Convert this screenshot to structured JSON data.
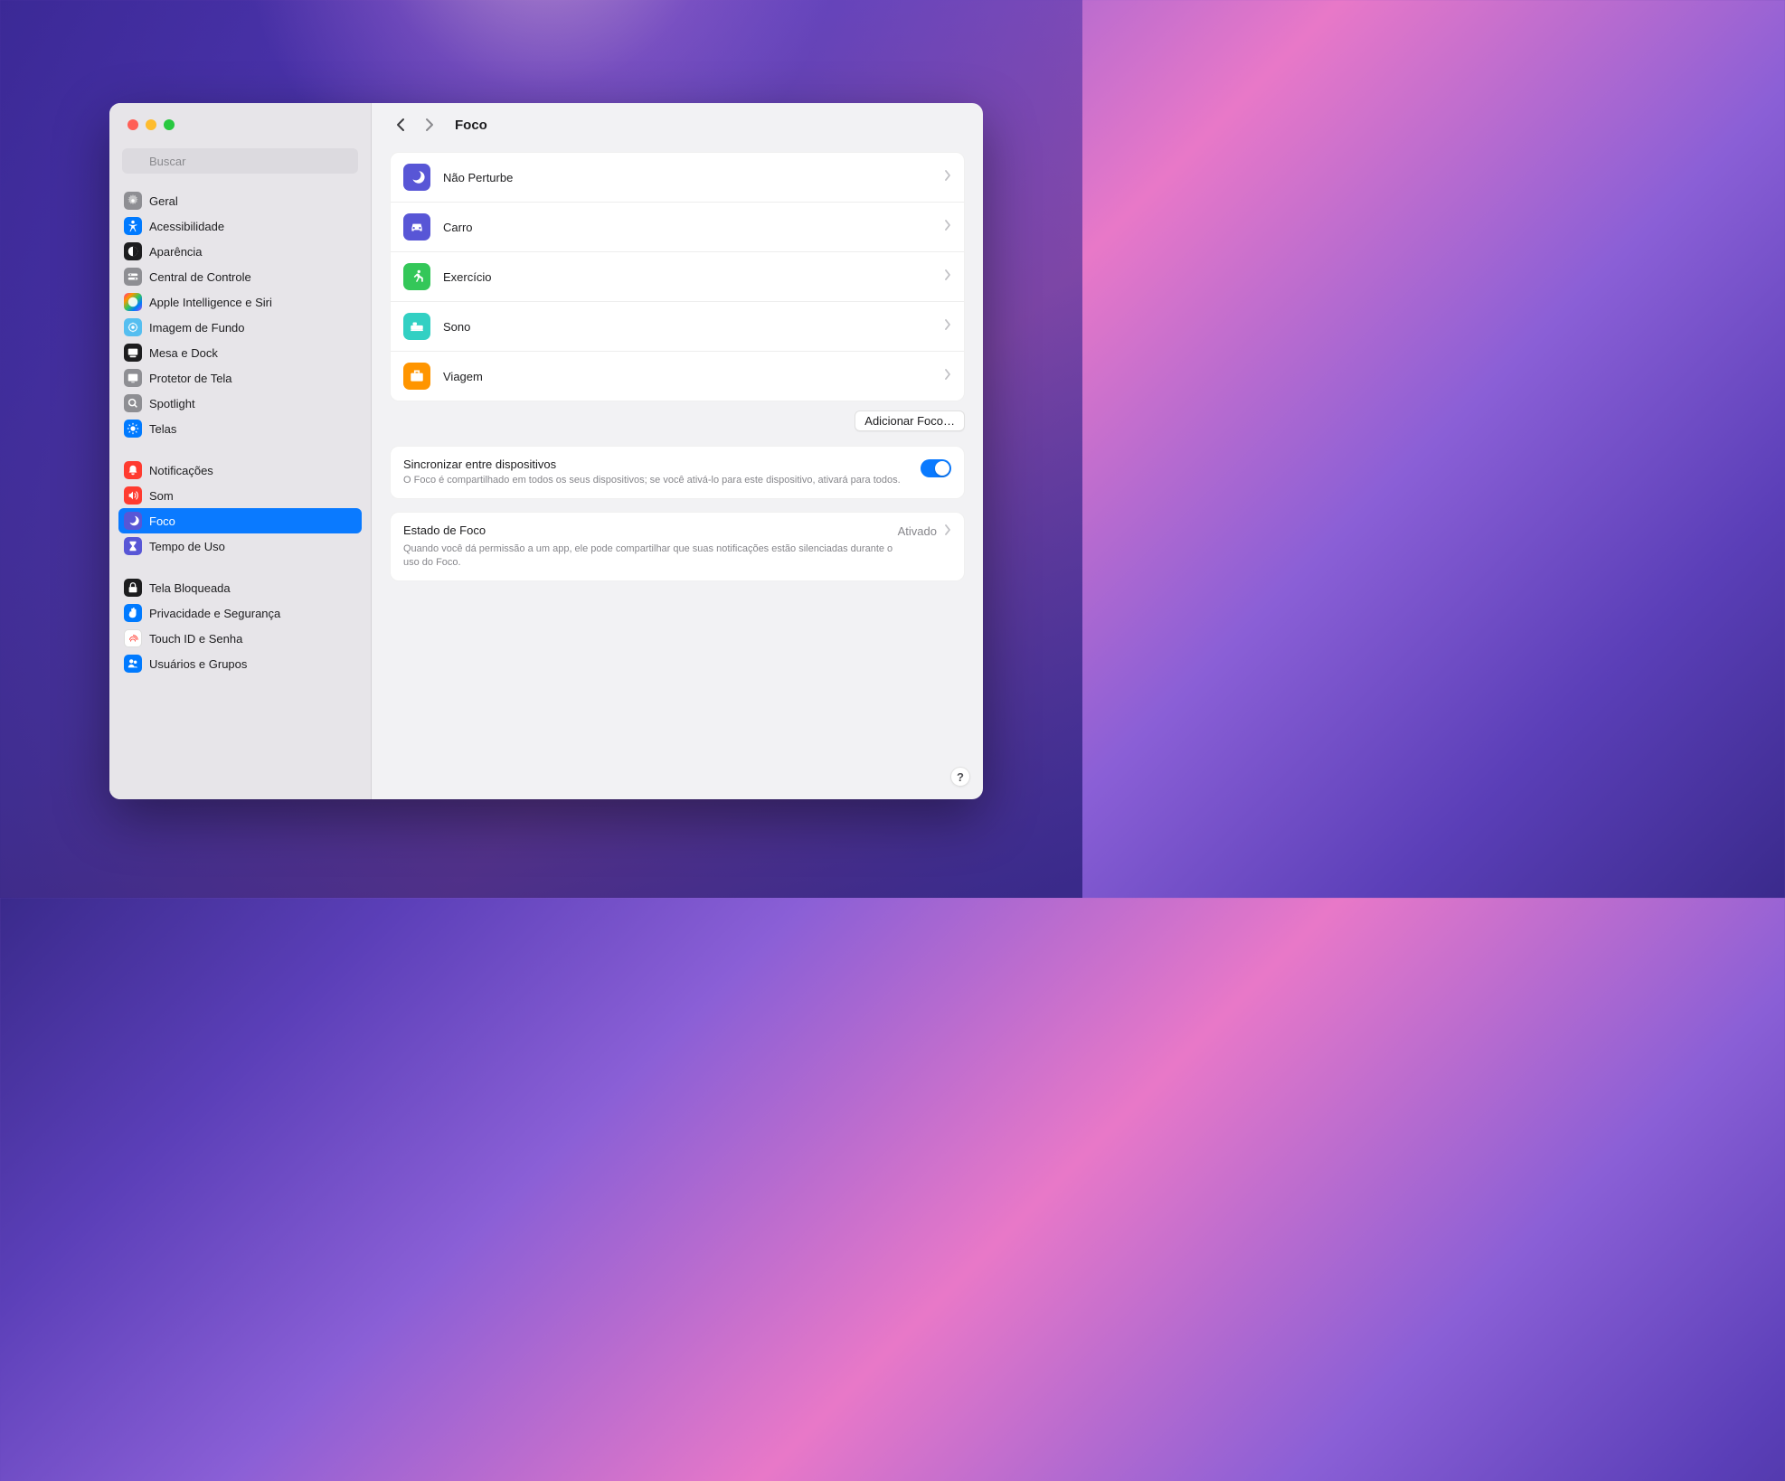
{
  "search": {
    "placeholder": "Buscar"
  },
  "sidebar": {
    "groups": [
      {
        "items": [
          {
            "label": "Geral",
            "icon": "gear",
            "color": "#8e8e93"
          },
          {
            "label": "Acessibilidade",
            "icon": "accessibility",
            "color": "#007aff"
          },
          {
            "label": "Aparência",
            "icon": "appearance",
            "color": "#1d1d1f"
          },
          {
            "label": "Central de Controle",
            "icon": "control-center",
            "color": "#8e8e93"
          },
          {
            "label": "Apple Intelligence e Siri",
            "icon": "siri",
            "color": "gradient"
          },
          {
            "label": "Imagem de Fundo",
            "icon": "wallpaper",
            "color": "#55bef0"
          },
          {
            "label": "Mesa e Dock",
            "icon": "dock",
            "color": "#1d1d1f"
          },
          {
            "label": "Protetor de Tela",
            "icon": "screensaver",
            "color": "#8e8e93"
          },
          {
            "label": "Spotlight",
            "icon": "search",
            "color": "#8e8e93"
          },
          {
            "label": "Telas",
            "icon": "displays",
            "color": "#007aff"
          }
        ]
      },
      {
        "items": [
          {
            "label": "Notificações",
            "icon": "bell",
            "color": "#ff3b30"
          },
          {
            "label": "Som",
            "icon": "sound",
            "color": "#ff3b30"
          },
          {
            "label": "Foco",
            "icon": "moon",
            "color": "#5856d6",
            "selected": true
          },
          {
            "label": "Tempo de Uso",
            "icon": "hourglass",
            "color": "#5856d6"
          }
        ]
      },
      {
        "items": [
          {
            "label": "Tela Bloqueada",
            "icon": "lock",
            "color": "#1d1d1f"
          },
          {
            "label": "Privacidade e Segurança",
            "icon": "hand",
            "color": "#007aff"
          },
          {
            "label": "Touch ID e Senha",
            "icon": "fingerprint",
            "color": "#ffffff"
          },
          {
            "label": "Usuários e Grupos",
            "icon": "users",
            "color": "#007aff"
          }
        ]
      }
    ]
  },
  "header": {
    "title": "Foco"
  },
  "focus_modes": [
    {
      "label": "Não Perturbe",
      "icon": "moon",
      "color": "#5856d6"
    },
    {
      "label": "Carro",
      "icon": "car",
      "color": "#5856d6"
    },
    {
      "label": "Exercício",
      "icon": "runner",
      "color": "#34c759"
    },
    {
      "label": "Sono",
      "icon": "bed",
      "color": "#32d0c3"
    },
    {
      "label": "Viagem",
      "icon": "briefcase",
      "color": "#ff9500"
    }
  ],
  "add_button": {
    "label": "Adicionar Foco…"
  },
  "sync_section": {
    "title": "Sincronizar entre dispositivos",
    "description": "O Foco é compartilhado em todos os seus dispositivos; se você ativá-lo para este dispositivo, ativará para todos."
  },
  "status_section": {
    "title": "Estado de Foco",
    "value": "Ativado",
    "description": "Quando você dá permissão a um app, ele pode compartilhar que suas notificações estão silenciadas durante o uso do Foco."
  },
  "help": {
    "label": "?"
  }
}
